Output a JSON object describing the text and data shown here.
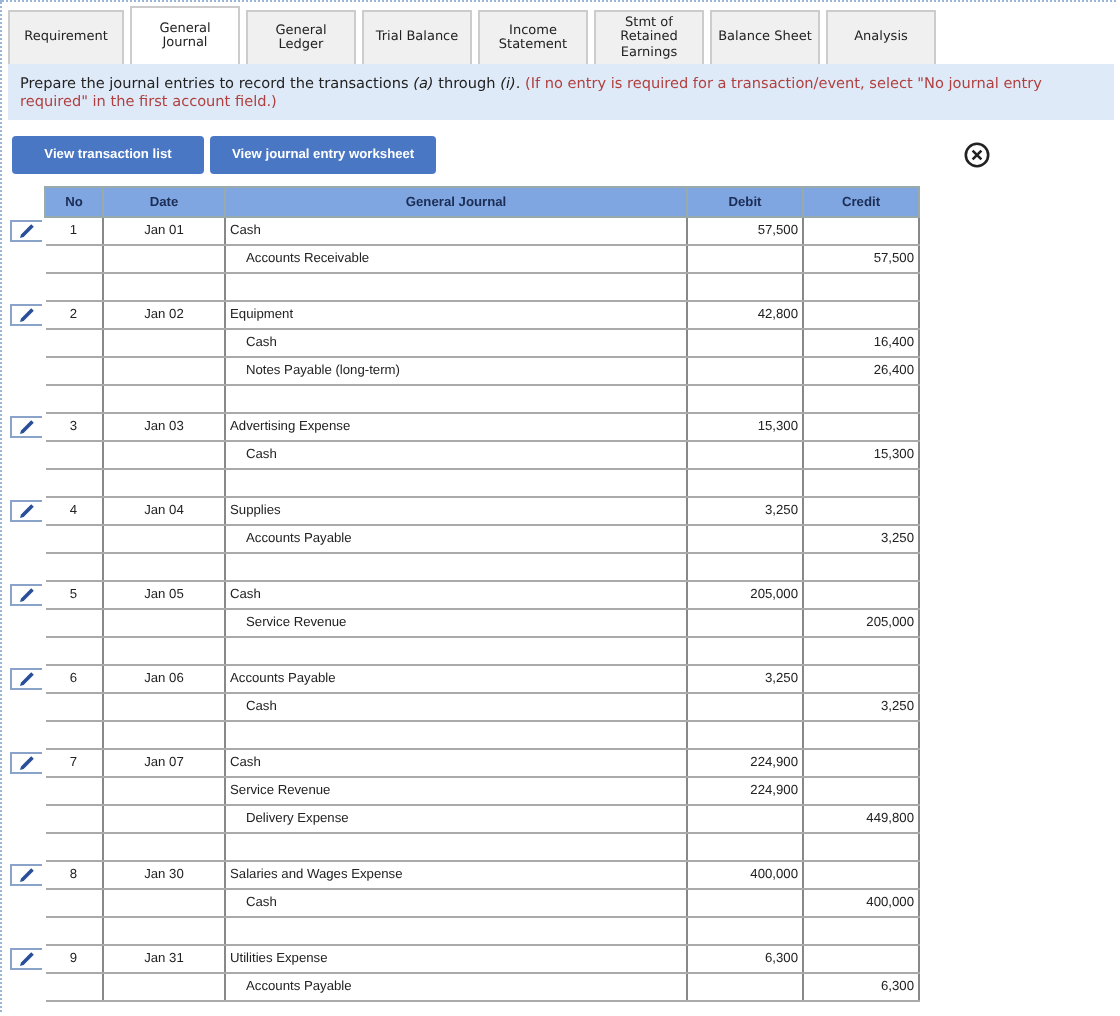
{
  "tabs": [
    {
      "label": "Requirement",
      "selected": false
    },
    {
      "label": "General\nJournal",
      "selected": true
    },
    {
      "label": "General\nLedger",
      "selected": false
    },
    {
      "label": "Trial Balance",
      "selected": false
    },
    {
      "label": "Income\nStatement",
      "selected": false
    },
    {
      "label": "Stmt of\nRetained\nEarnings",
      "selected": false
    },
    {
      "label": "Balance Sheet",
      "selected": false
    },
    {
      "label": "Analysis",
      "selected": false
    }
  ],
  "instruction": {
    "text": "Prepare the journal entries to record the transactions *(a)* through *(i)*. ",
    "note": "(If no entry is required for a transaction/event, select \"No journal entry required\" in the first account field.)"
  },
  "buttons": [
    "View transaction list",
    "View journal entry worksheet"
  ],
  "table": {
    "columns": [
      "No",
      "Date",
      "General Journal",
      "Debit",
      "Credit"
    ],
    "entries": [
      {
        "no": "1",
        "date": "Jan 01",
        "lines": [
          {
            "account": "Cash",
            "debit": "57,500"
          },
          {
            "account": "Accounts Receivable",
            "credit": "57,500"
          }
        ]
      },
      {
        "no": "2",
        "date": "Jan 02",
        "lines": [
          {
            "account": "Equipment",
            "debit": "42,800"
          },
          {
            "account": "Cash",
            "credit": "16,400"
          },
          {
            "account": "Notes Payable (long-term)",
            "credit": "26,400"
          }
        ]
      },
      {
        "no": "3",
        "date": "Jan 03",
        "lines": [
          {
            "account": "Advertising Expense",
            "debit": "15,300"
          },
          {
            "account": "Cash",
            "credit": "15,300"
          }
        ]
      },
      {
        "no": "4",
        "date": "Jan 04",
        "lines": [
          {
            "account": "Supplies",
            "debit": "3,250"
          },
          {
            "account": "Accounts Payable",
            "credit": "3,250"
          }
        ]
      },
      {
        "no": "5",
        "date": "Jan 05",
        "lines": [
          {
            "account": "Cash",
            "debit": "205,000"
          },
          {
            "account": "Service Revenue",
            "credit": "205,000"
          }
        ]
      },
      {
        "no": "6",
        "date": "Jan 06",
        "lines": [
          {
            "account": "Accounts Payable",
            "debit": "3,250"
          },
          {
            "account": "Cash",
            "credit": "3,250"
          }
        ]
      },
      {
        "no": "7",
        "date": "Jan 07",
        "lines": [
          {
            "account": "Cash",
            "debit": "224,900"
          },
          {
            "account": "Service Revenue",
            "debit": "224,900"
          },
          {
            "account": "Delivery Expense",
            "credit": "449,800"
          }
        ]
      },
      {
        "no": "8",
        "date": "Jan 30",
        "lines": [
          {
            "account": "Salaries and Wages Expense",
            "debit": "400,000"
          },
          {
            "account": "Cash",
            "credit": "400,000"
          }
        ]
      },
      {
        "no": "9",
        "date": "Jan 31",
        "lines": [
          {
            "account": "Utilities Expense",
            "debit": "6,300"
          },
          {
            "account": "Accounts Payable",
            "credit": "6,300"
          }
        ]
      }
    ]
  }
}
